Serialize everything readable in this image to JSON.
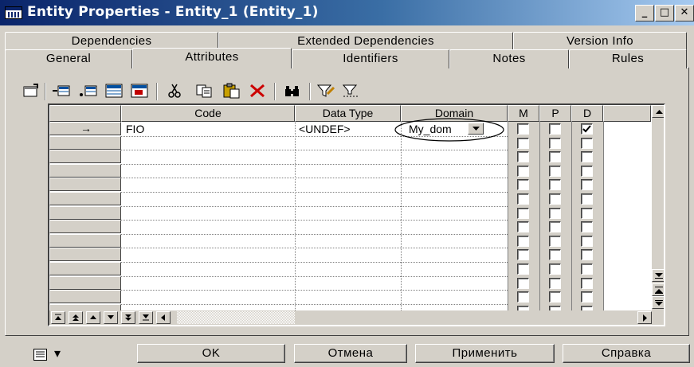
{
  "window": {
    "title": "Entity Properties - Entity_1 (Entity_1)",
    "controls": {
      "minimize": "_",
      "maximize": "□",
      "close": "✕"
    }
  },
  "tabs": {
    "row1": [
      "Dependencies",
      "Extended Dependencies",
      "Version Info"
    ],
    "row2": [
      "General",
      "Attributes",
      "Identifiers",
      "Notes",
      "Rules"
    ],
    "active": "Attributes"
  },
  "toolbar": {
    "icons": [
      "properties-icon",
      "insert-row-icon",
      "add-row-icon",
      "add-attributes-icon",
      "reuse-attributes-icon",
      "cut-icon",
      "copy-icon",
      "paste-icon",
      "delete-icon",
      "find-icon",
      "filter-icon",
      "filter-options-icon"
    ]
  },
  "grid": {
    "columns": [
      "Code",
      "Data Type",
      "Domain",
      "M",
      "P",
      "D"
    ],
    "rows": [
      {
        "marker": "→",
        "code": "FIO",
        "data_type": "<UNDEF>",
        "domain": "My_dom",
        "m": false,
        "p": false,
        "d": true
      }
    ],
    "empty_rows": 13,
    "nav_buttons": [
      "move-to-top-icon",
      "move-up-page-icon",
      "move-up-icon",
      "move-down-icon",
      "move-down-page-icon",
      "move-to-bottom-icon",
      "scroll-left-icon"
    ]
  },
  "buttons": {
    "menu": "▾",
    "ok": "OK",
    "cancel": "Отмена",
    "apply": "Применить",
    "help": "Справка"
  },
  "colors": {
    "titlebar_start": "#0a246a",
    "titlebar_end": "#a6caf0",
    "face": "#d4d0c8",
    "delete_red": "#cc0000"
  }
}
